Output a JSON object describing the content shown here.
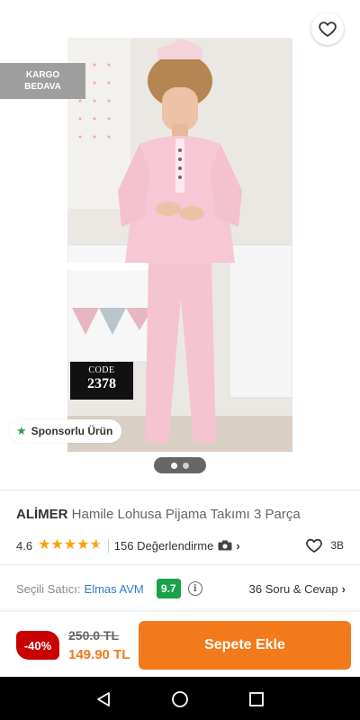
{
  "colors": {
    "accent": "#f27a1a",
    "discount_red": "#c80000",
    "seller_score_green": "#16a34a",
    "link_blue": "#2f7ad8",
    "star_gold": "#ffa000",
    "sponsored_star_green": "#2e9e46"
  },
  "header": {
    "back_icon": "arrow-left-icon",
    "share_icon": "share-icon",
    "favorite_icon": "heart-outline-icon"
  },
  "gallery": {
    "cargo_badge": [
      "KARGO",
      "BEDAVA"
    ],
    "code_tag": {
      "label": "CODE",
      "number": "2378"
    },
    "sponsored_label": "Sponsorlu Ürün",
    "sponsored_icon": "star-icon",
    "image_count": 2,
    "active_image_index": 0
  },
  "product": {
    "brand": "ALİMER",
    "name": "Hamile Lohusa Pijama Takımı 3 Parça"
  },
  "rating": {
    "score": "4.6",
    "stars": 4.6,
    "reviews_label": "156 Değerlendirme",
    "camera_icon": "camera-icon",
    "likes": "3B",
    "like_icon": "heart-outline-icon"
  },
  "seller": {
    "label": "Seçili Satıcı:",
    "name": "Elmas AVM",
    "score": "9.7",
    "info_icon": "info-icon",
    "qa_label": "36 Soru & Cevap"
  },
  "price": {
    "discount": "-40%",
    "old": "250.0 TL",
    "new": "149.90 TL",
    "add_to_cart": "Sepete Ekle"
  },
  "system_nav": {
    "back": "nav-back-icon",
    "home": "nav-home-icon",
    "recents": "nav-recents-icon"
  }
}
